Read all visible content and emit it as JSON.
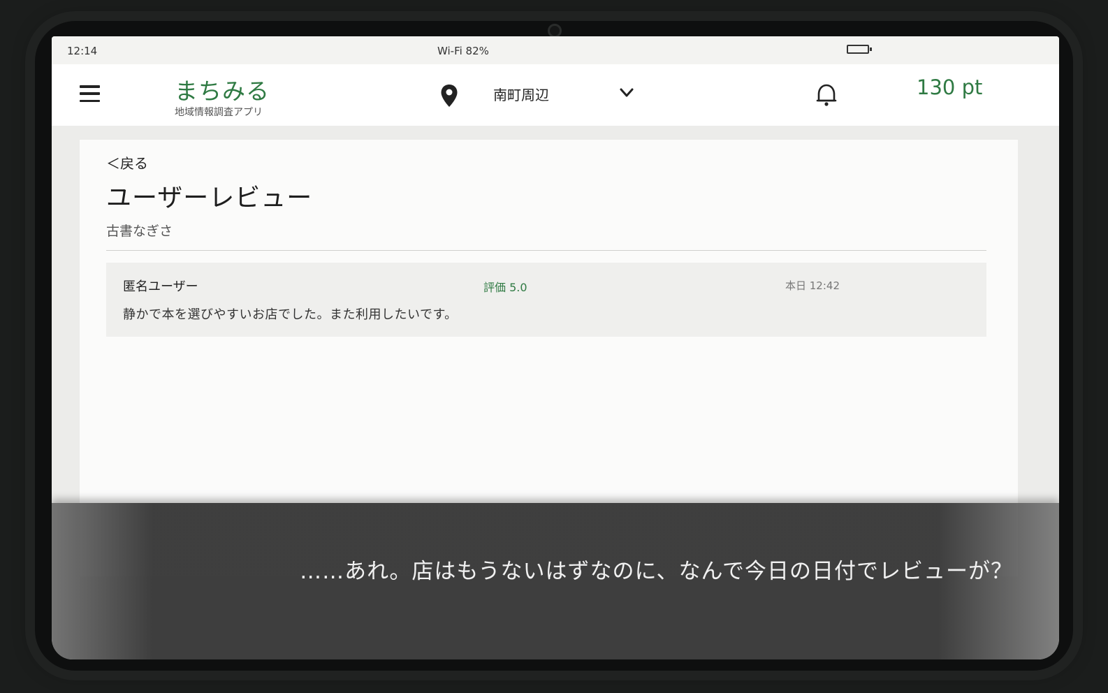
{
  "status_bar": {
    "time": "12:14",
    "wifi": "Wi-Fi  82%"
  },
  "header": {
    "app_name": "まちみる",
    "app_subtitle": "地域情報調査アプリ",
    "location": "南町周辺",
    "points": "130 pt"
  },
  "page": {
    "back_label": "＜戻る",
    "title": "ユーザーレビュー",
    "shop_name": "古書なぎさ"
  },
  "reviews": [
    {
      "author": "匿名ユーザー",
      "rating": "評価 5.0",
      "date": "本日 12:42",
      "text": "静かで本を選びやすいお店でした。また利用したいです。"
    }
  ],
  "subtitle": "……あれ。店はもうないはずなのに、なんで今日の日付でレビューが？",
  "colors": {
    "accent": "#2f7a43",
    "overlay": "#373737"
  }
}
